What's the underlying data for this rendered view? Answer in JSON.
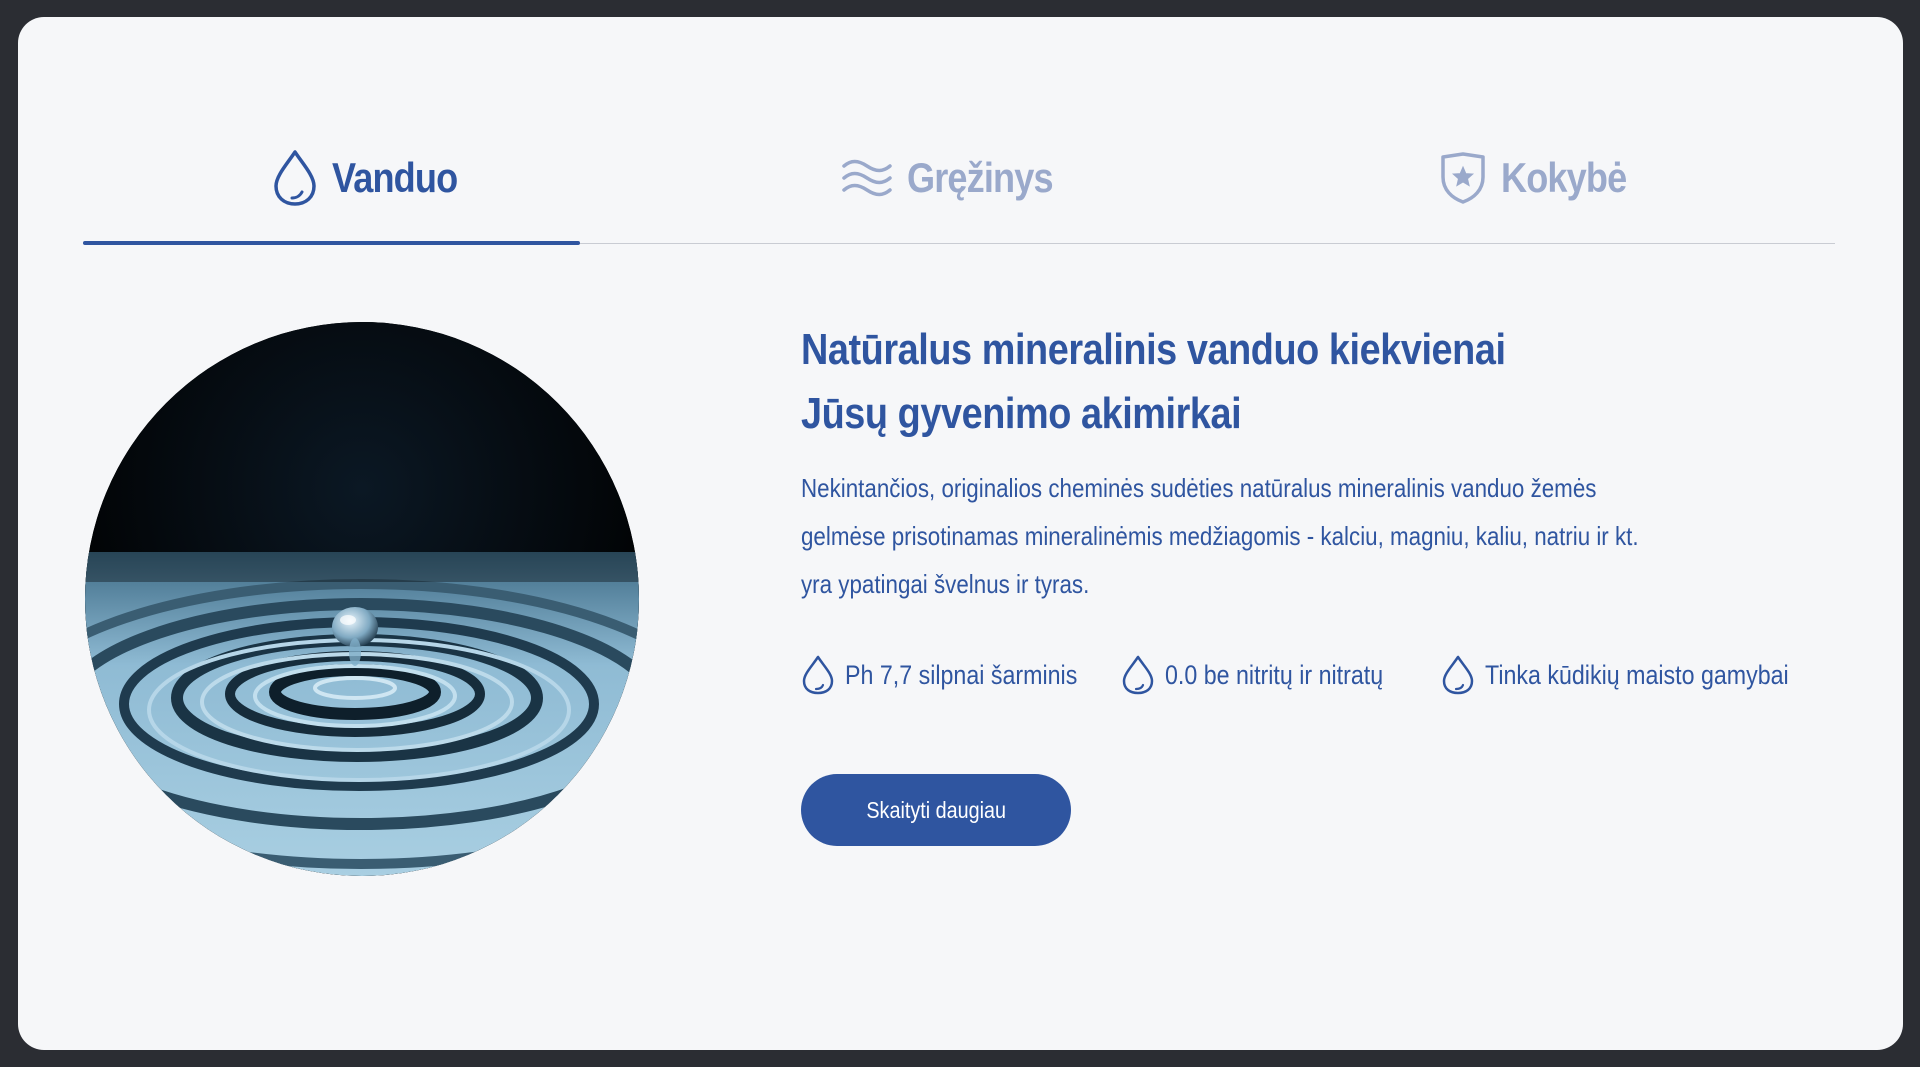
{
  "tabs": [
    {
      "label": "Vanduo",
      "icon": "water-drop-icon",
      "active": true
    },
    {
      "label": "Gręžinys",
      "icon": "waves-icon",
      "active": false
    },
    {
      "label": "Kokybė",
      "icon": "shield-star-icon",
      "active": false
    }
  ],
  "main": {
    "image": "water-drop-ripple-photo",
    "headline": "Natūralus mineralinis vanduo kiekvienai Jūsų gyvenimo akimirkai",
    "description": "Nekintančios, originalios cheminės sudėties natūralus mineralinis vanduo žemės gelmėse prisotinamas mineralinėmis medžiagomis - kalciu, magniu, kaliu, natriu ir kt. yra ypatingai švelnus ir tyras.",
    "features": [
      {
        "label": "Ph 7,7 silpnai šarminis",
        "icon": "water-drop-icon"
      },
      {
        "label": "0.0 be nitritų ir nitratų",
        "icon": "water-drop-icon"
      },
      {
        "label": "Tinka kūdikių maisto gamybai",
        "icon": "water-drop-icon"
      }
    ],
    "cta_label": "Skaityti daugiau"
  },
  "colors": {
    "accent": "#2f55a0",
    "inactive_tab": "#9aa9cb",
    "background": "#f6f7f9",
    "frame": "#2b2d33"
  }
}
